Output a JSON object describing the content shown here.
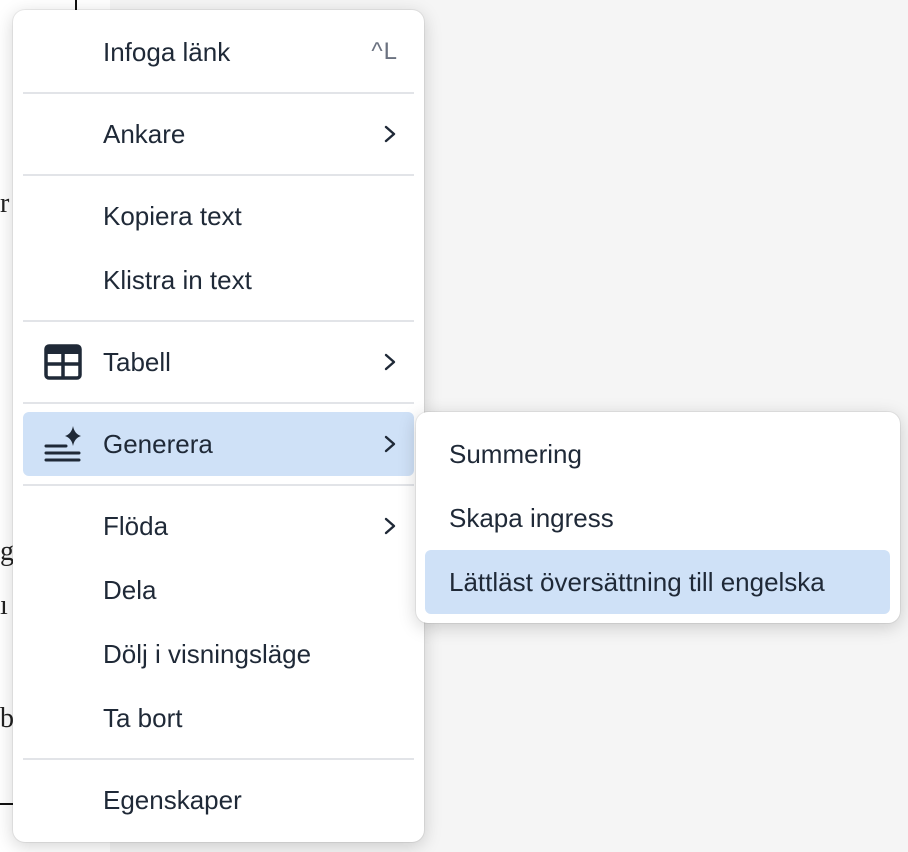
{
  "document": {
    "visible_chars": [
      "r",
      "g",
      "ı",
      "b"
    ]
  },
  "context_menu": {
    "items": [
      {
        "label": "Infoga länk",
        "shortcut": "^L"
      },
      {
        "label": "Ankare"
      },
      {
        "label": "Kopiera text"
      },
      {
        "label": "Klistra in text"
      },
      {
        "label": "Tabell",
        "icon": "table-icon"
      },
      {
        "label": "Generera",
        "icon": "sparkle-lines-icon",
        "active": true
      },
      {
        "label": "Flöda"
      },
      {
        "label": "Dela"
      },
      {
        "label": "Dölj i visningsläge"
      },
      {
        "label": "Ta bort"
      },
      {
        "label": "Egenskaper"
      }
    ]
  },
  "generate_submenu": {
    "items": [
      {
        "label": "Summering"
      },
      {
        "label": "Skapa ingress"
      },
      {
        "label": "Lättläst översättning till engelska",
        "active": true
      }
    ]
  },
  "colors": {
    "active_background": "#cfe1f7",
    "separator": "#e2e4e8",
    "text": "#1f2937",
    "shortcut_text": "#6b7280"
  }
}
